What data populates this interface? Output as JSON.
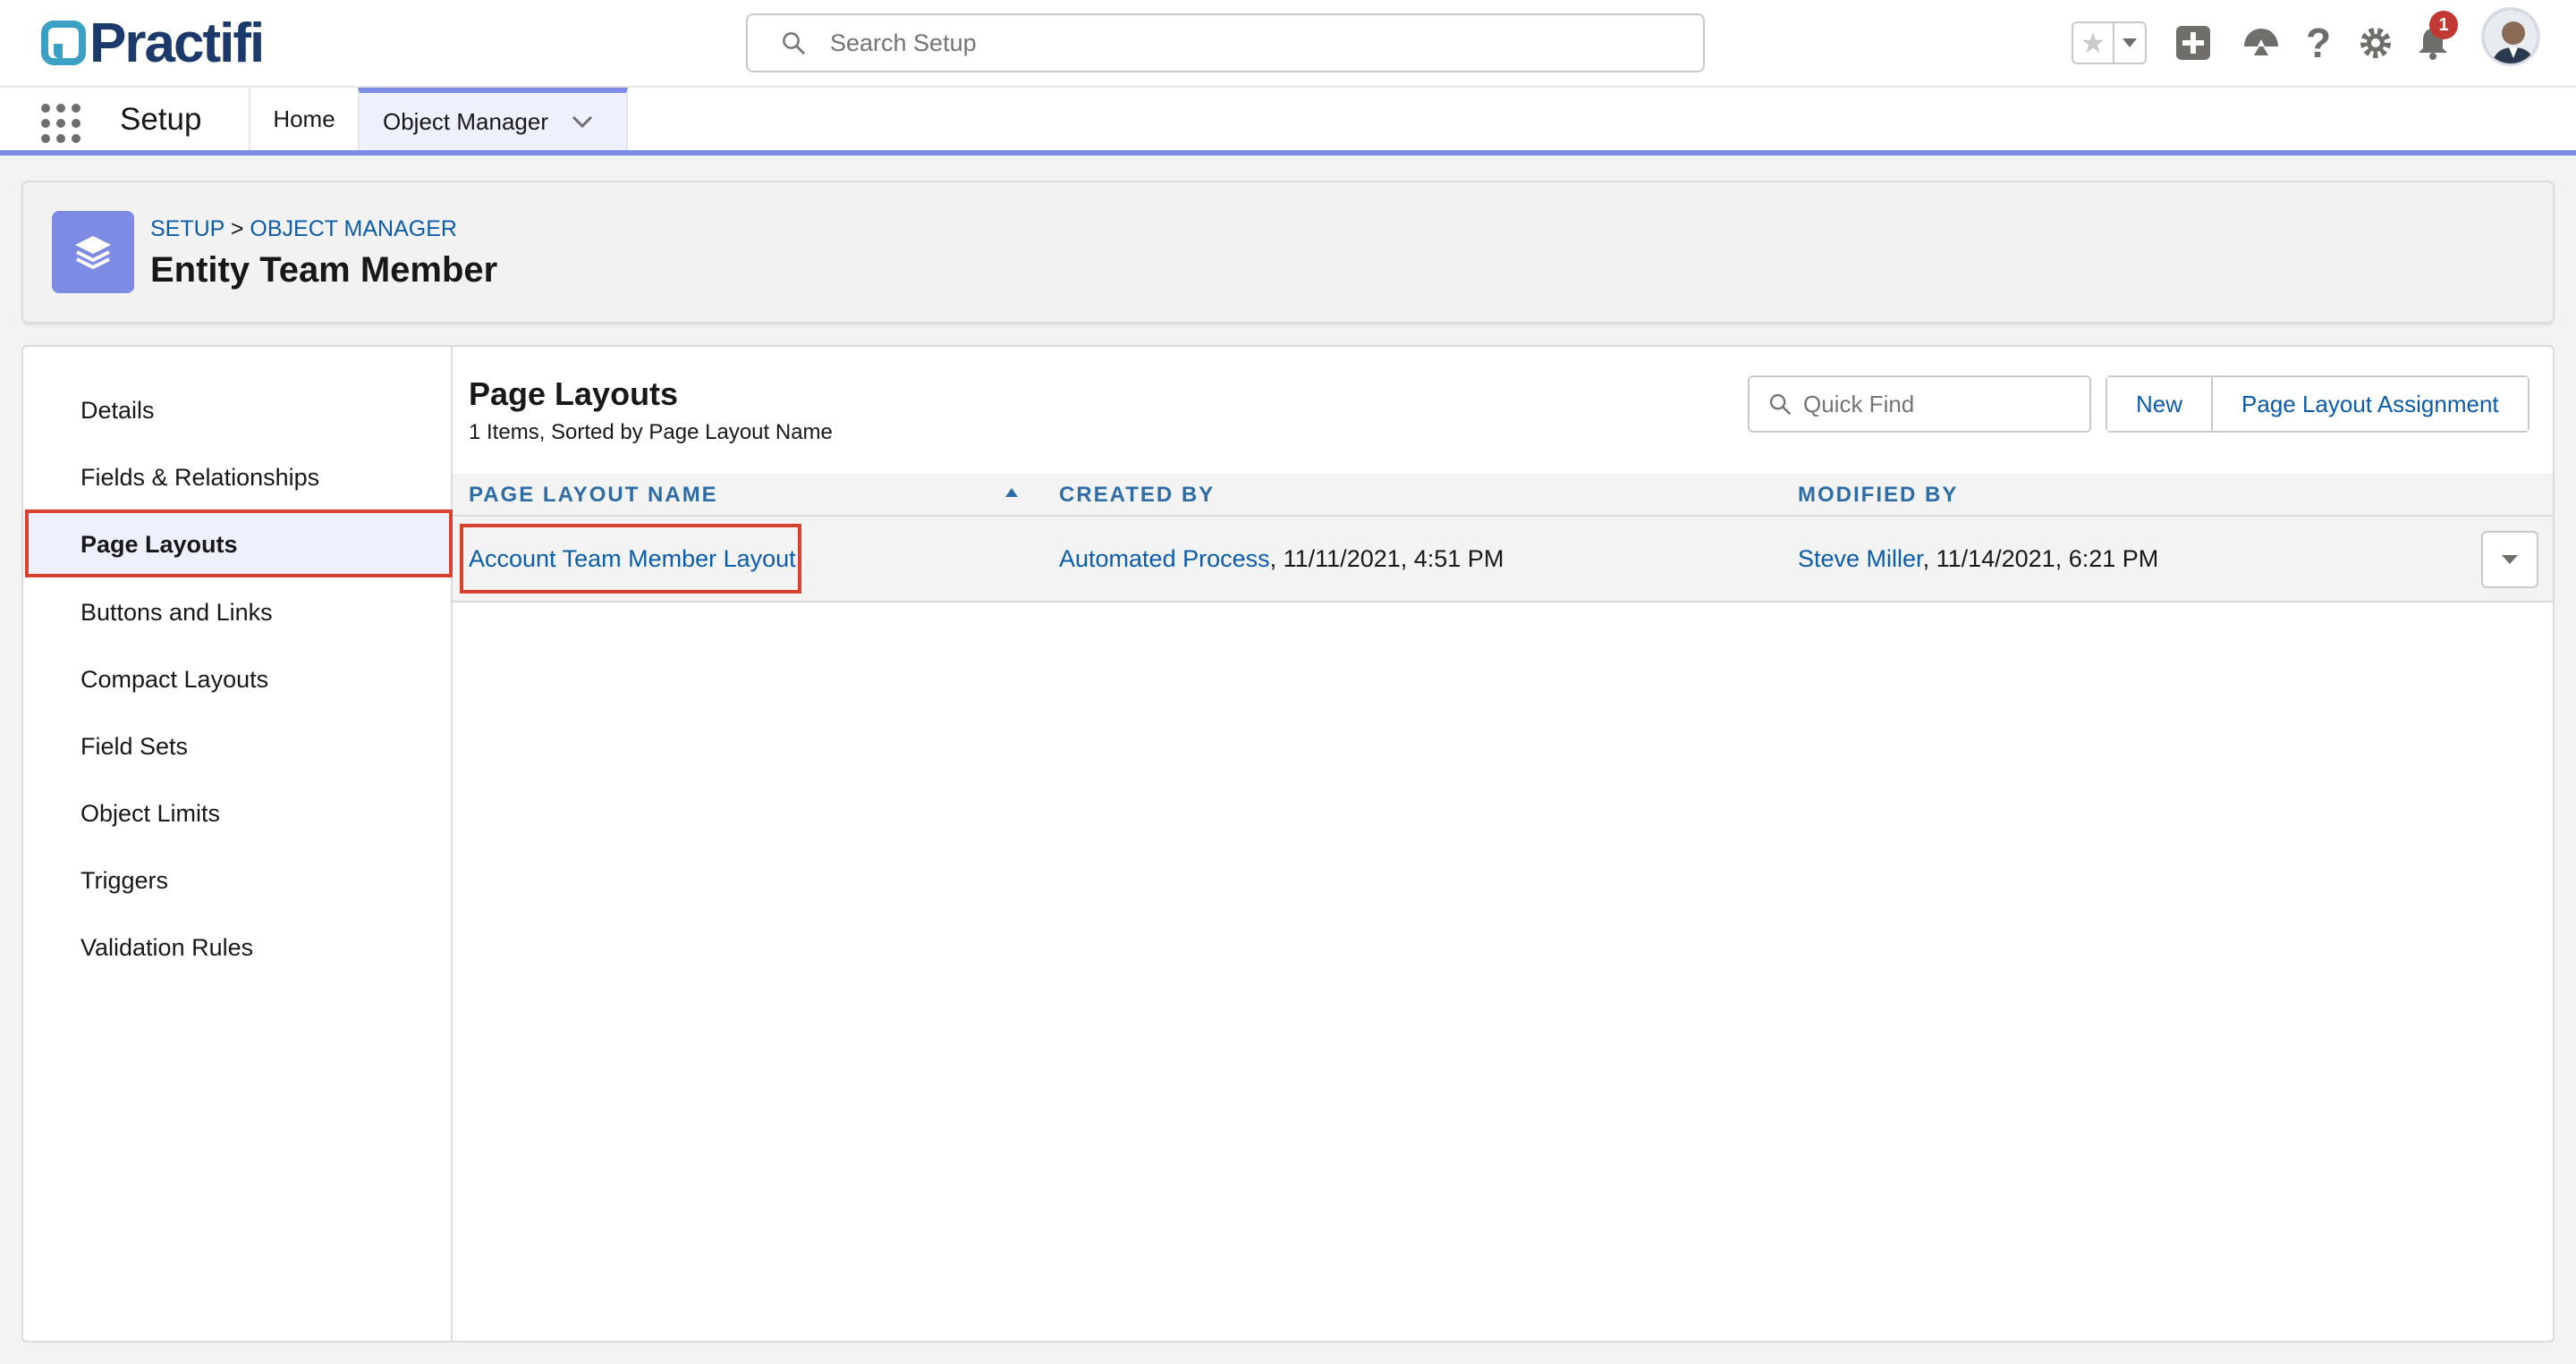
{
  "header": {
    "brand": "Practifi",
    "search_placeholder": "Search Setup",
    "notification_count": "1",
    "icons": [
      "star-icon",
      "chevron-down-icon",
      "add-icon",
      "trailhead-icon",
      "help-icon",
      "gear-icon",
      "bell-icon",
      "avatar"
    ]
  },
  "nav": {
    "app_name": "Setup",
    "tabs": [
      {
        "label": "Home"
      },
      {
        "label": "Object Manager"
      }
    ]
  },
  "page_header": {
    "breadcrumb": [
      "SETUP",
      ">",
      "OBJECT MANAGER"
    ],
    "title": "Entity Team Member",
    "icon": "layers-icon"
  },
  "sidebar": {
    "items": [
      {
        "label": "Details"
      },
      {
        "label": "Fields & Relationships"
      },
      {
        "label": "Page Layouts",
        "active": true
      },
      {
        "label": "Buttons and Links"
      },
      {
        "label": "Compact Layouts"
      },
      {
        "label": "Field Sets"
      },
      {
        "label": "Object Limits"
      },
      {
        "label": "Triggers"
      },
      {
        "label": "Validation Rules"
      }
    ]
  },
  "content": {
    "title": "Page Layouts",
    "subtitle": "1 Items, Sorted by Page Layout Name",
    "quick_find_placeholder": "Quick Find",
    "buttons": {
      "new": "New",
      "assignment": "Page Layout Assignment"
    },
    "columns": [
      "PAGE LAYOUT NAME",
      "CREATED BY",
      "MODIFIED BY"
    ],
    "rows": [
      {
        "name": "Account Team Member Layout",
        "created_by": "Automated Process",
        "created_date": ", 11/11/2021, 4:51 PM",
        "modified_by": "Steve Miller",
        "modified_date": ", 11/14/2021, 6:21 PM"
      }
    ]
  },
  "colors": {
    "accent": "#7e8be4",
    "link": "#0b5cab",
    "highlight": "#d9412f",
    "badge": "#c23934"
  }
}
